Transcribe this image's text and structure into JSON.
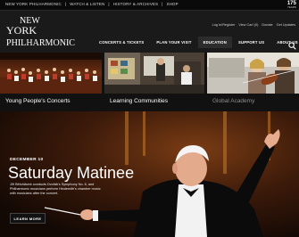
{
  "topbar": {
    "links": [
      "New York Philharmonic",
      "Watch & Listen",
      "History & Archives",
      "Shop"
    ],
    "anniversary": {
      "number": "175",
      "caption": "YEARS"
    }
  },
  "header": {
    "logo": {
      "line1": "NEW",
      "line2": "YORK",
      "line3": "PHILHARMONIC"
    },
    "utility": [
      "Log In/Register",
      "View Cart (0)",
      "Donate",
      "Get Updates"
    ],
    "nav": [
      "Concerts & Tickets",
      "Plan Your Visit",
      "Education",
      "Support Us",
      "About Us"
    ],
    "active_nav": "Education",
    "search_icon": "search-icon"
  },
  "tiles": [
    {
      "label": "Young People's Concerts"
    },
    {
      "label": "Learning Communities"
    },
    {
      "label": "Global Academy"
    }
  ],
  "hero": {
    "date": "DECEMBER 10",
    "title": "Saturday Matinee",
    "description": "Jiří Bělohlávek conducts Dvořák's Symphony No. 6, and Philharmonic musicians perform Hindemith's chamber music with musicians after the concert.",
    "button": "LEARN MORE"
  },
  "colors": {
    "header_bg": "#1a1a1a",
    "topbar_bg": "#0a0a0a",
    "hero_bg": "#1c0f08"
  }
}
